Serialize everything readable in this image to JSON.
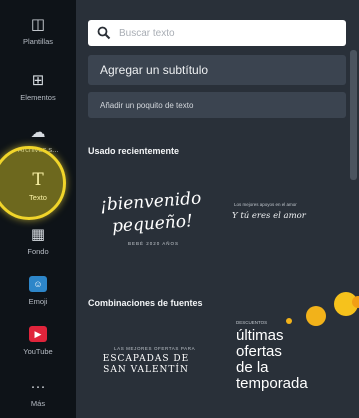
{
  "rail": {
    "items": [
      {
        "label": "Plantillas",
        "icon": "template-icon",
        "glyph": "◫"
      },
      {
        "label": "Elementos",
        "icon": "elements-icon",
        "glyph": "⊞"
      },
      {
        "label": "Archivos s...",
        "icon": "upload-icon",
        "glyph": "☁"
      },
      {
        "label": "Texto",
        "icon": "text-icon",
        "glyph": "T"
      },
      {
        "label": "Fondo",
        "icon": "background-icon",
        "glyph": "▦"
      },
      {
        "label": "Emoji",
        "icon": "emoji-icon",
        "glyph": "☺"
      },
      {
        "label": "YouTube",
        "icon": "youtube-icon",
        "glyph": "▶"
      },
      {
        "label": "Más",
        "icon": "more-icon",
        "glyph": "···"
      }
    ]
  },
  "panel": {
    "search_placeholder": "Buscar texto",
    "add_subtitle": "Agregar un subtítulo",
    "add_body": "Añadir un poquito de texto",
    "recent_title": "Usado recientemente",
    "combos_title": "Combinaciones de fuentes"
  },
  "cards": {
    "bienvenido": {
      "line1": "¡bienvenido",
      "line2": "pequeño!",
      "small": "BEBÉ 2020 AÑOS"
    },
    "amor": {
      "small": "Los mejores apoyos en el amor",
      "script": "Y tú eres el amor"
    },
    "escapadas": {
      "small": "LAS MEJORES OFERTAS PARA",
      "line1": "ESCAPADAS DE",
      "line2": "SAN VALENTÍN"
    },
    "ofertas": {
      "small": "DESCUENTOS",
      "line1": "últimas",
      "line2": "ofertas",
      "line3": "de la",
      "line4": "temporada"
    }
  },
  "colors": {
    "rail_bg": "#0e1318",
    "panel_bg": "#293039",
    "highlight": "#f1d52a",
    "emoji_tile": "#2d86c9",
    "youtube_tile": "#e0243b"
  }
}
